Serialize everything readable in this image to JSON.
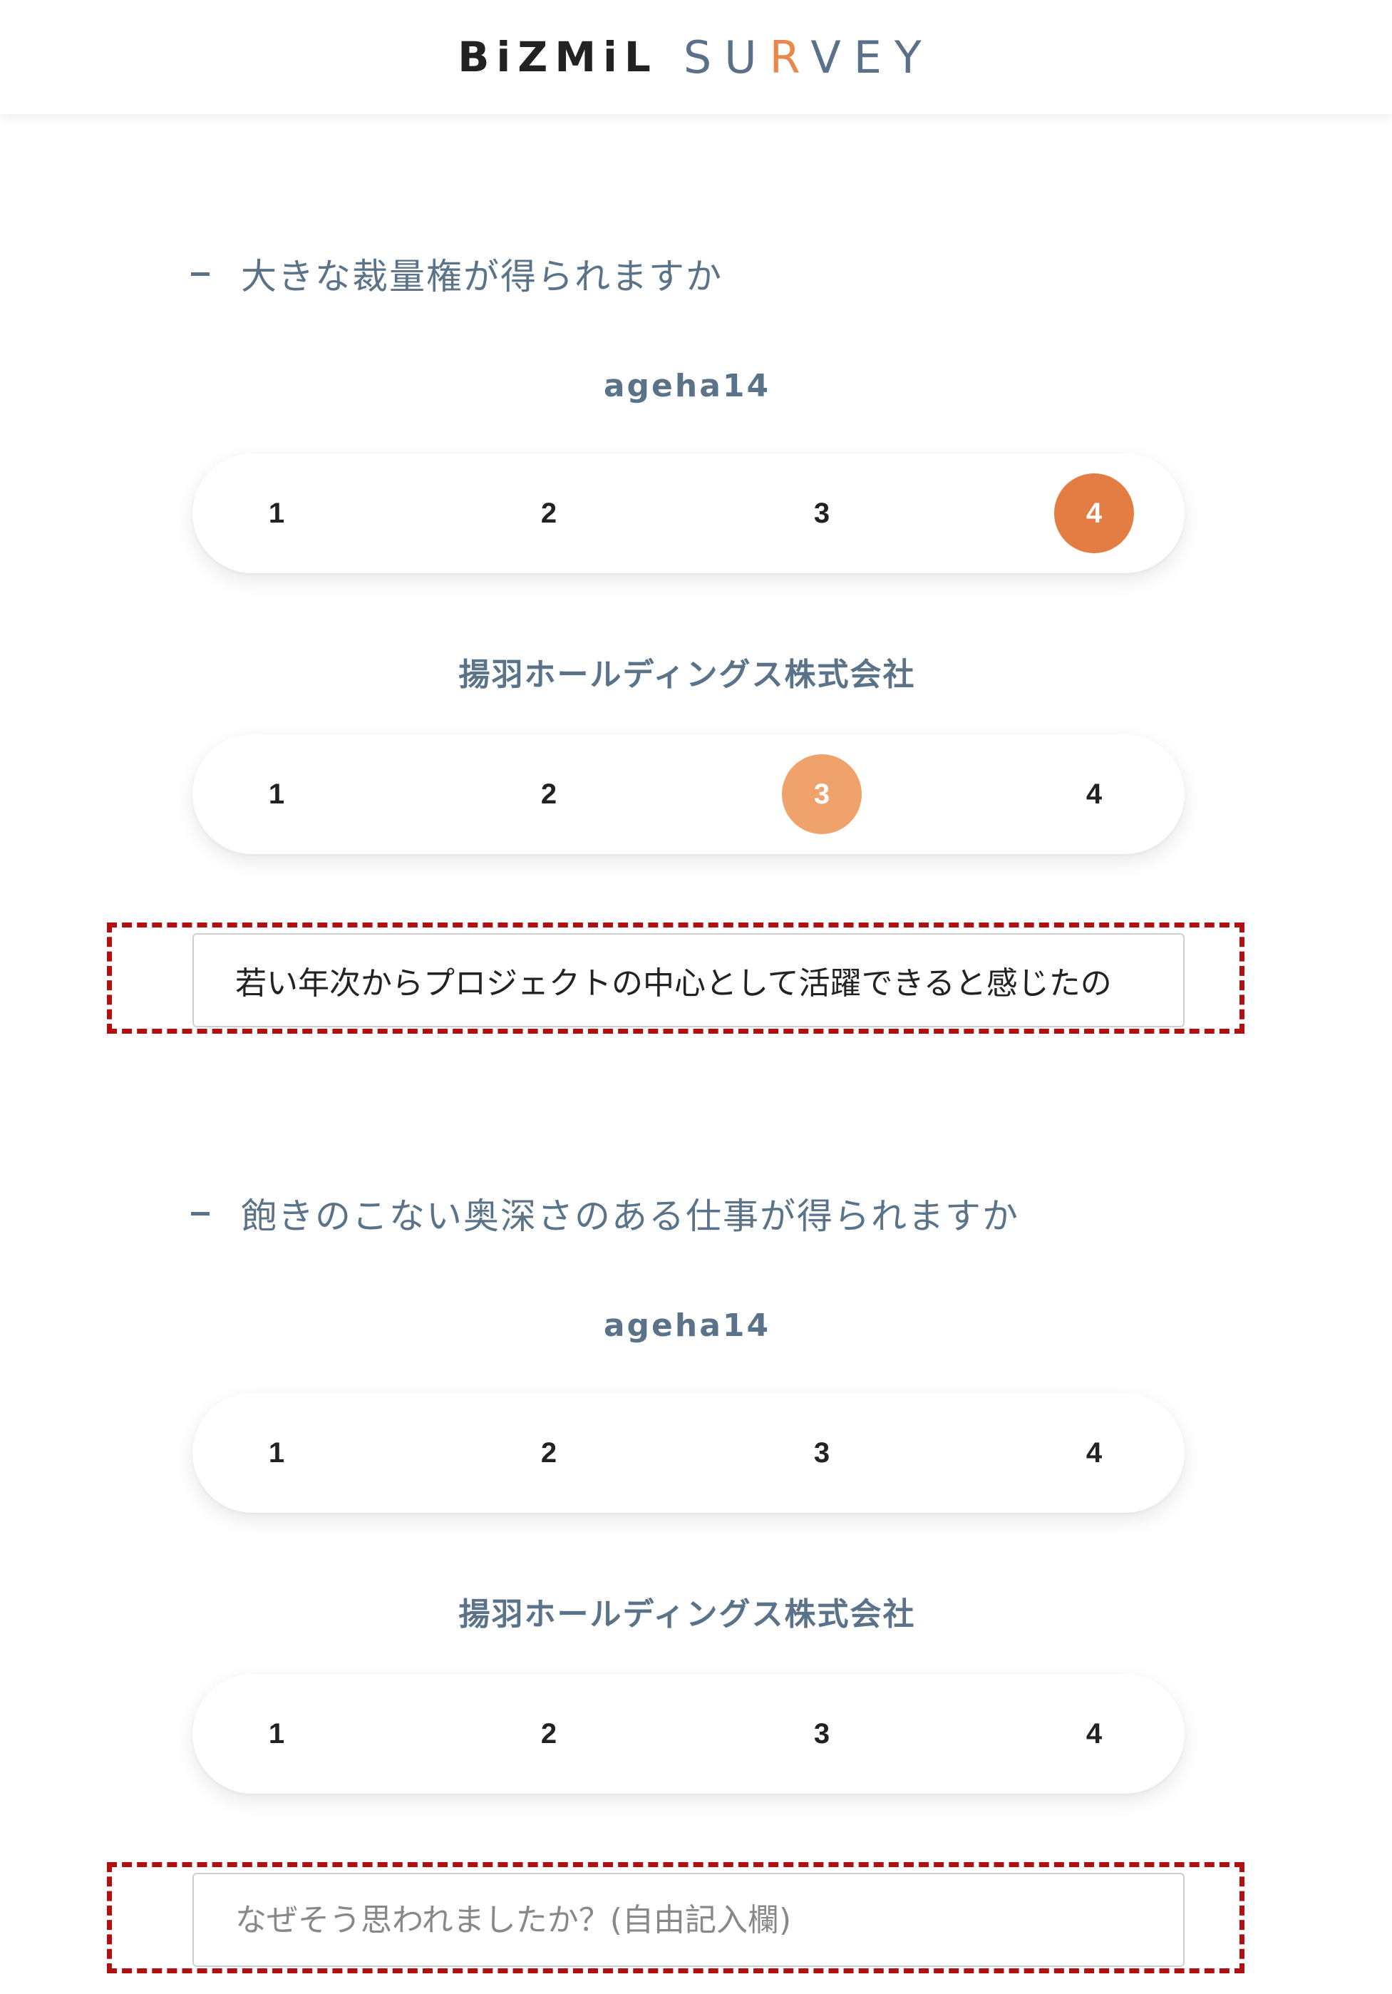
{
  "header": {
    "logo_brand": "BiZMiL",
    "logo_product_pre": "SU",
    "logo_product_r": "R",
    "logo_product_post": "VEY"
  },
  "questions": [
    {
      "title": "大きな裁量権が得られますか",
      "ratings": [
        {
          "respondent": "ageha14",
          "options": [
            "1",
            "2",
            "3",
            "4"
          ],
          "selected": "4",
          "selected_color": "#e37d44"
        },
        {
          "respondent": "揚羽ホールディングス株式会社",
          "options": [
            "1",
            "2",
            "3",
            "4"
          ],
          "selected": "3",
          "selected_color": "#f0a26c"
        }
      ],
      "comment": {
        "value": "若い年次からプロジェクトの中心として活躍できると感じたの",
        "placeholder": ""
      }
    },
    {
      "title": "飽きのこない奥深さのある仕事が得られますか",
      "ratings": [
        {
          "respondent": "ageha14",
          "options": [
            "1",
            "2",
            "3",
            "4"
          ],
          "selected": null
        },
        {
          "respondent": "揚羽ホールディングス株式会社",
          "options": [
            "1",
            "2",
            "3",
            "4"
          ],
          "selected": null
        }
      ],
      "comment": {
        "value": "",
        "placeholder": "なぜそう思われましたか？(自由記入欄)"
      }
    }
  ],
  "colors": {
    "highlight_border": "#b01010",
    "text_slate": "#5b7388",
    "accent_orange": "#e37d44",
    "accent_orange_light": "#f0a26c"
  }
}
